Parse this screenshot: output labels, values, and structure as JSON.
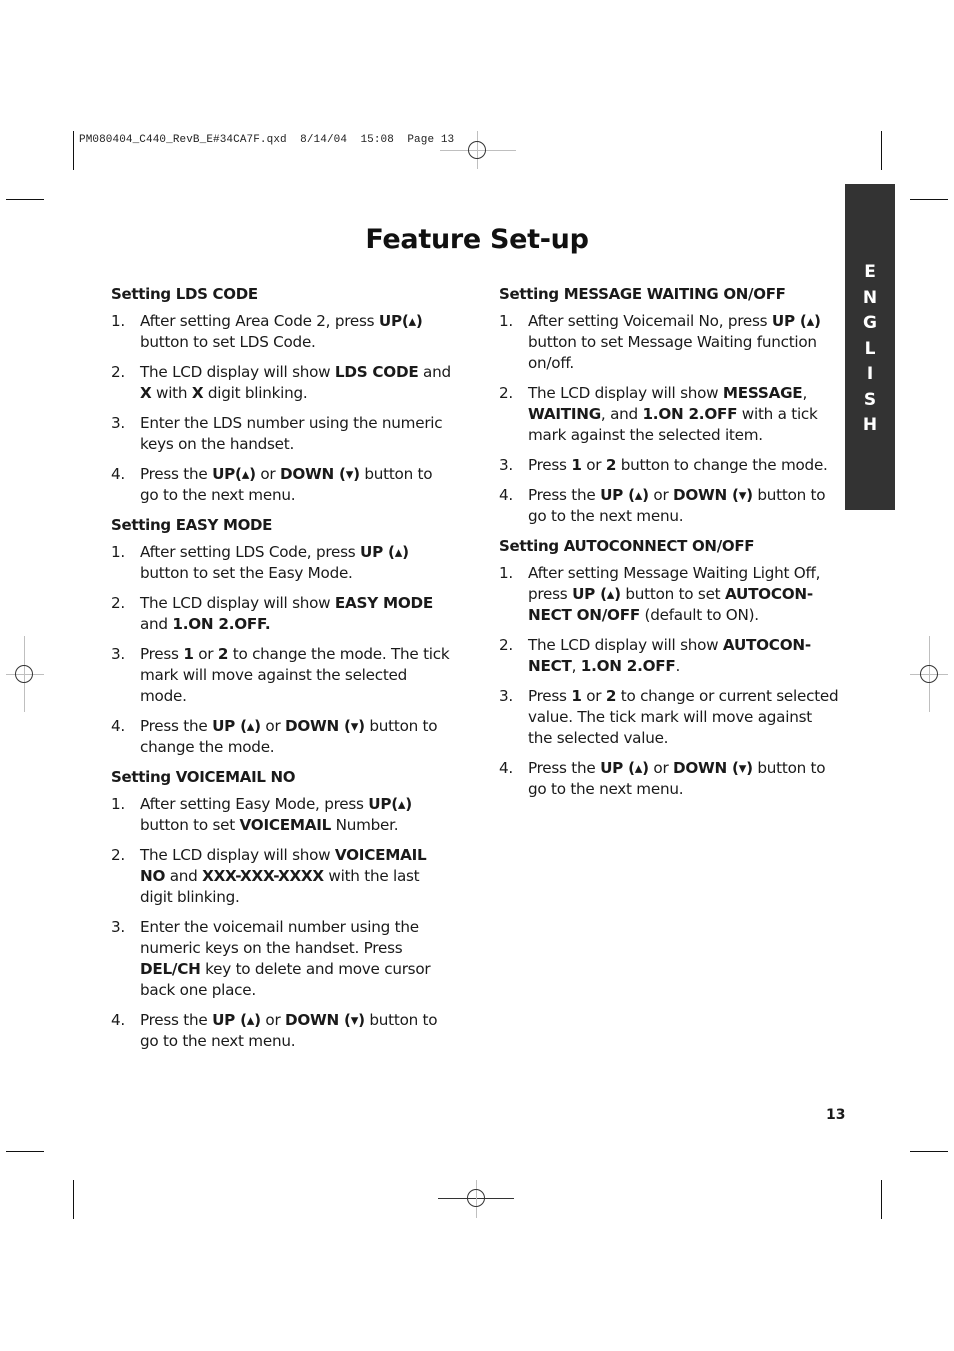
{
  "slug": "PM080404_C440_RevB_E#34CA7F.qxd  8/14/04  15:08  Page 13",
  "title": "Feature Set-up",
  "language_tab": {
    "letters": [
      "E",
      "N",
      "G",
      "L",
      "I",
      "S",
      "H"
    ],
    "background": "#333333",
    "color": "#ffffff"
  },
  "page_number": "13",
  "columns": [
    {
      "sections": [
        {
          "heading": "Setting LDS CODE",
          "steps": [
            {
              "num": "1.",
              "parts": [
                {
                  "t": "After setting Area Code 2, press "
                },
                {
                  "t": "UP(▴)",
                  "b": true
                },
                {
                  "t": " button to set LDS Code."
                }
              ]
            },
            {
              "num": "2.",
              "parts": [
                {
                  "t": "The LCD display will show "
                },
                {
                  "t": "LDS CODE",
                  "b": true
                },
                {
                  "t": " and "
                },
                {
                  "t": "X",
                  "b": true
                },
                {
                  "t": " with "
                },
                {
                  "t": "X",
                  "b": true
                },
                {
                  "t": " digit blinking."
                }
              ]
            },
            {
              "num": "3.",
              "parts": [
                {
                  "t": "Enter the LDS number using the numeric keys on the handset."
                }
              ]
            },
            {
              "num": "4.",
              "parts": [
                {
                  "t": "Press the "
                },
                {
                  "t": "UP(▴)",
                  "b": true
                },
                {
                  "t": " or "
                },
                {
                  "t": "DOWN (▾)",
                  "b": true
                },
                {
                  "t": " button to go to the next menu."
                }
              ]
            }
          ]
        },
        {
          "heading": "Setting EASY MODE",
          "steps": [
            {
              "num": "1.",
              "parts": [
                {
                  "t": "After setting LDS Code, press "
                },
                {
                  "t": "UP (▴)",
                  "b": true
                },
                {
                  "t": " button to set the Easy Mode."
                }
              ]
            },
            {
              "num": "2.",
              "parts": [
                {
                  "t": "The LCD display will show "
                },
                {
                  "t": "EASY MODE",
                  "b": true
                },
                {
                  "t": " and "
                },
                {
                  "t": "1.ON  2.OFF.",
                  "b": true
                }
              ]
            },
            {
              "num": "3.",
              "parts": [
                {
                  "t": "Press "
                },
                {
                  "t": "1",
                  "b": true
                },
                {
                  "t": " or "
                },
                {
                  "t": "2",
                  "b": true
                },
                {
                  "t": " to change the mode. The tick mark will move against the selected mode."
                }
              ]
            },
            {
              "num": "4.",
              "parts": [
                {
                  "t": "Press the "
                },
                {
                  "t": "UP (▴)",
                  "b": true
                },
                {
                  "t": " or "
                },
                {
                  "t": "DOWN (▾)",
                  "b": true
                },
                {
                  "t": " button to change the mode."
                }
              ]
            }
          ]
        },
        {
          "heading": "Setting VOICEMAIL NO",
          "steps": [
            {
              "num": "1.",
              "parts": [
                {
                  "t": "After setting Easy Mode, press "
                },
                {
                  "t": "UP(▴)",
                  "b": true
                },
                {
                  "t": " button to set "
                },
                {
                  "t": "VOICEMAIL",
                  "b": true
                },
                {
                  "t": " Number."
                }
              ]
            },
            {
              "num": "2.",
              "parts": [
                {
                  "t": "The LCD display will show "
                },
                {
                  "t": "VOICEMAIL NO",
                  "b": true
                },
                {
                  "t": " and "
                },
                {
                  "t": "XXX-XXX-XXXX",
                  "b": true
                },
                {
                  "t": " with the last digit blinking."
                }
              ]
            },
            {
              "num": "3.",
              "parts": [
                {
                  "t": "Enter the voicemail number using the numeric keys on the handset. Press "
                },
                {
                  "t": "DEL/CH",
                  "b": true
                },
                {
                  "t": " key to delete and move cursor back one place."
                }
              ]
            },
            {
              "num": "4.",
              "parts": [
                {
                  "t": "Press the "
                },
                {
                  "t": "UP (▴)",
                  "b": true
                },
                {
                  "t": " or "
                },
                {
                  "t": "DOWN (▾)",
                  "b": true
                },
                {
                  "t": " button to go to the next menu."
                }
              ]
            }
          ]
        }
      ]
    },
    {
      "sections": [
        {
          "heading": "Setting MESSAGE WAITING ON/OFF",
          "steps": [
            {
              "num": "1.",
              "parts": [
                {
                  "t": "After setting Voicemail No, press "
                },
                {
                  "t": "UP (▴)",
                  "b": true
                },
                {
                  "t": " button to set Message Waiting function on/off."
                }
              ]
            },
            {
              "num": "2.",
              "parts": [
                {
                  "t": "The LCD display will show "
                },
                {
                  "t": "MESSAGE",
                  "b": true
                },
                {
                  "t": ", "
                },
                {
                  "t": "WAITING",
                  "b": true
                },
                {
                  "t": ", and "
                },
                {
                  "t": "1.ON  2.OFF",
                  "b": true
                },
                {
                  "t": " with a tick mark against the selected item."
                }
              ]
            },
            {
              "num": "3.",
              "parts": [
                {
                  "t": "Press "
                },
                {
                  "t": "1",
                  "b": true
                },
                {
                  "t": " or "
                },
                {
                  "t": "2",
                  "b": true
                },
                {
                  "t": " button to change the mode."
                }
              ]
            },
            {
              "num": "4.",
              "parts": [
                {
                  "t": "Press the "
                },
                {
                  "t": "UP (▴)",
                  "b": true
                },
                {
                  "t": " or "
                },
                {
                  "t": "DOWN (▾)",
                  "b": true
                },
                {
                  "t": " button to go to the next menu."
                }
              ]
            }
          ]
        },
        {
          "heading": "Setting AUTOCONNECT ON/OFF",
          "steps": [
            {
              "num": "1.",
              "parts": [
                {
                  "t": "After setting Message Waiting Light Off, press "
                },
                {
                  "t": "UP (▴)",
                  "b": true
                },
                {
                  "t": " button to set "
                },
                {
                  "t": "AUTOCON-NECT ON/OFF",
                  "b": true
                },
                {
                  "t": " (default to ON)."
                }
              ]
            },
            {
              "num": "2.",
              "parts": [
                {
                  "t": "The LCD display will show "
                },
                {
                  "t": "AUTOCON-NECT",
                  "b": true
                },
                {
                  "t": ", "
                },
                {
                  "t": "1.ON   2.OFF",
                  "b": true
                },
                {
                  "t": "."
                }
              ]
            },
            {
              "num": "3.",
              "parts": [
                {
                  "t": "Press "
                },
                {
                  "t": "1",
                  "b": true
                },
                {
                  "t": " or "
                },
                {
                  "t": "2",
                  "b": true
                },
                {
                  "t": " to change or current selected value. The tick mark will move against the selected value."
                }
              ]
            },
            {
              "num": "4.",
              "parts": [
                {
                  "t": "Press the "
                },
                {
                  "t": "UP (▴)",
                  "b": true
                },
                {
                  "t": " or "
                },
                {
                  "t": "DOWN (▾)",
                  "b": true
                },
                {
                  "t": " button to go to the next menu."
                }
              ]
            }
          ]
        }
      ]
    }
  ]
}
